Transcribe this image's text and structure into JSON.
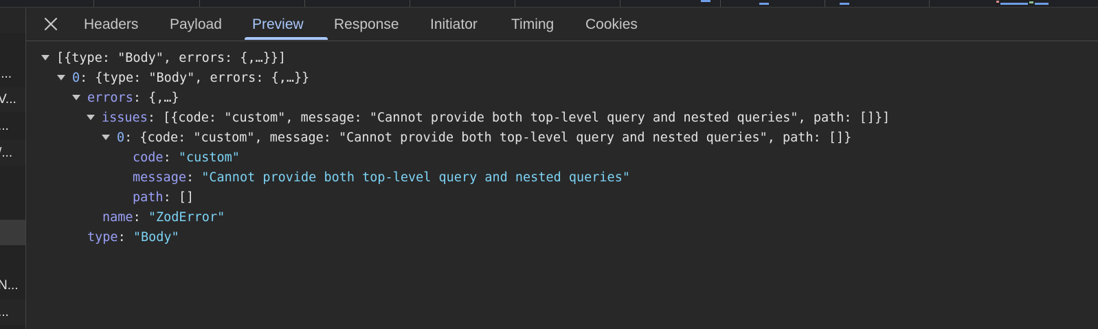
{
  "tabs": [
    {
      "label": "Headers"
    },
    {
      "label": "Payload"
    },
    {
      "label": "Preview"
    },
    {
      "label": "Response"
    },
    {
      "label": "Initiator"
    },
    {
      "label": "Timing"
    },
    {
      "label": "Cookies"
    }
  ],
  "active_tab": "Preview",
  "left_rows": [
    "l...",
    "V...",
    "...",
    "/...",
    "N...",
    "..."
  ],
  "tree": {
    "root_summary": "[{type: \"Body\", errors: {,…}}]",
    "item0_index": "0",
    "item0_summary": "{type: \"Body\", errors: {,…}}",
    "errors_key": "errors",
    "errors_summary": "{,…}",
    "issues_key": "issues",
    "issues_summary": "[{code: \"custom\", message: \"Cannot provide both top-level query and nested queries\", path: []}]",
    "issue0_index": "0",
    "issue0_summary": "{code: \"custom\", message: \"Cannot provide both top-level query and nested queries\", path: []}",
    "code_key": "code",
    "code_value": "\"custom\"",
    "message_key": "message",
    "message_value": "\"Cannot provide both top-level query and nested queries\"",
    "path_key": "path",
    "path_value": "[]",
    "name_key": "name",
    "name_value": "\"ZodError\"",
    "type_key": "type",
    "type_value": "\"Body\""
  },
  "colors": {
    "background": "#282828",
    "active_tab": "#a8c7fa",
    "key": "#9aa0f7",
    "string": "#7cd3f5",
    "text": "#e3e3e3"
  }
}
